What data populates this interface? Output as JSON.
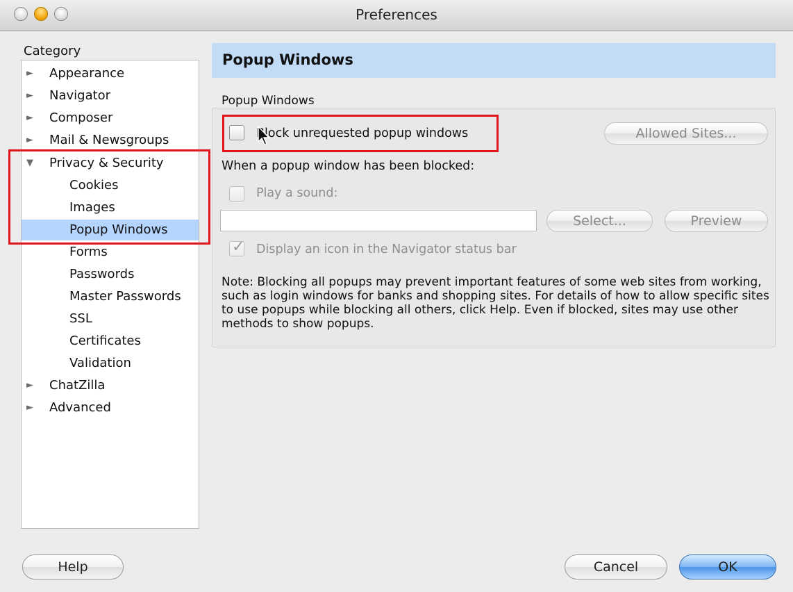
{
  "window": {
    "title": "Preferences"
  },
  "sidebar": {
    "category_label": "Category",
    "items": [
      {
        "label": "Appearance",
        "expander": "►"
      },
      {
        "label": "Navigator",
        "expander": "►"
      },
      {
        "label": "Composer",
        "expander": "►"
      },
      {
        "label": "Mail & Newsgroups",
        "expander": "►"
      },
      {
        "label": "Privacy & Security",
        "expander": "▼"
      },
      {
        "label": "Cookies"
      },
      {
        "label": "Images"
      },
      {
        "label": "Popup Windows",
        "selected": true
      },
      {
        "label": "Forms"
      },
      {
        "label": "Passwords"
      },
      {
        "label": "Master Passwords"
      },
      {
        "label": "SSL"
      },
      {
        "label": "Certificates"
      },
      {
        "label": "Validation"
      },
      {
        "label": "ChatZilla",
        "expander": "►"
      },
      {
        "label": "Advanced",
        "expander": "►"
      }
    ]
  },
  "main": {
    "header": "Popup Windows",
    "group_label": "Popup Windows",
    "block_checkbox": {
      "label": "Block unrequested popup windows",
      "checked": false
    },
    "allowed_sites_button": "Allowed Sites...",
    "when_blocked_label": "When a popup window has been blocked:",
    "play_sound": {
      "label": "Play a sound:",
      "checked": false
    },
    "sound_file_value": "",
    "select_button": "Select...",
    "preview_button": "Preview",
    "display_icon": {
      "label": "Display an icon in the Navigator status bar",
      "checked": true
    },
    "note": "Note: Blocking all popups may prevent important features of some web sites from working, such as login windows for banks and shopping sites. For details of how to allow specific sites to use popups while blocking all others, click Help. Even if blocked, sites may use other methods to show popups."
  },
  "footer": {
    "help": "Help",
    "cancel": "Cancel",
    "ok": "OK"
  },
  "colors": {
    "highlight": "#e0141d",
    "selection": "#b5d5ff",
    "header_band": "#c2dbf7",
    "default_button": "#4b94e6"
  }
}
